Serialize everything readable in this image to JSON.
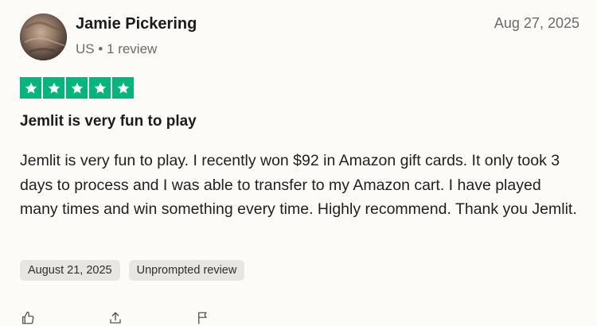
{
  "reviewer": {
    "name": "Jamie Pickering",
    "meta": "US • 1 review"
  },
  "review": {
    "date": "Aug 27, 2025",
    "rating": 5,
    "star_color": "#00b67a",
    "title": "Jemlit is very fun to play",
    "body": "Jemlit is very fun to play. I recently won $92 in Amazon gift cards. It only took 3 days to process and I was able to transfer to my Amazon cart. I have played many times and win something every time. Highly recommend. Thank you Jemlit.",
    "tags": [
      "August 21, 2025",
      "Unprompted review"
    ]
  },
  "icons": {
    "actions": [
      "thumbs-up-icon",
      "share-icon",
      "flag-icon"
    ]
  }
}
